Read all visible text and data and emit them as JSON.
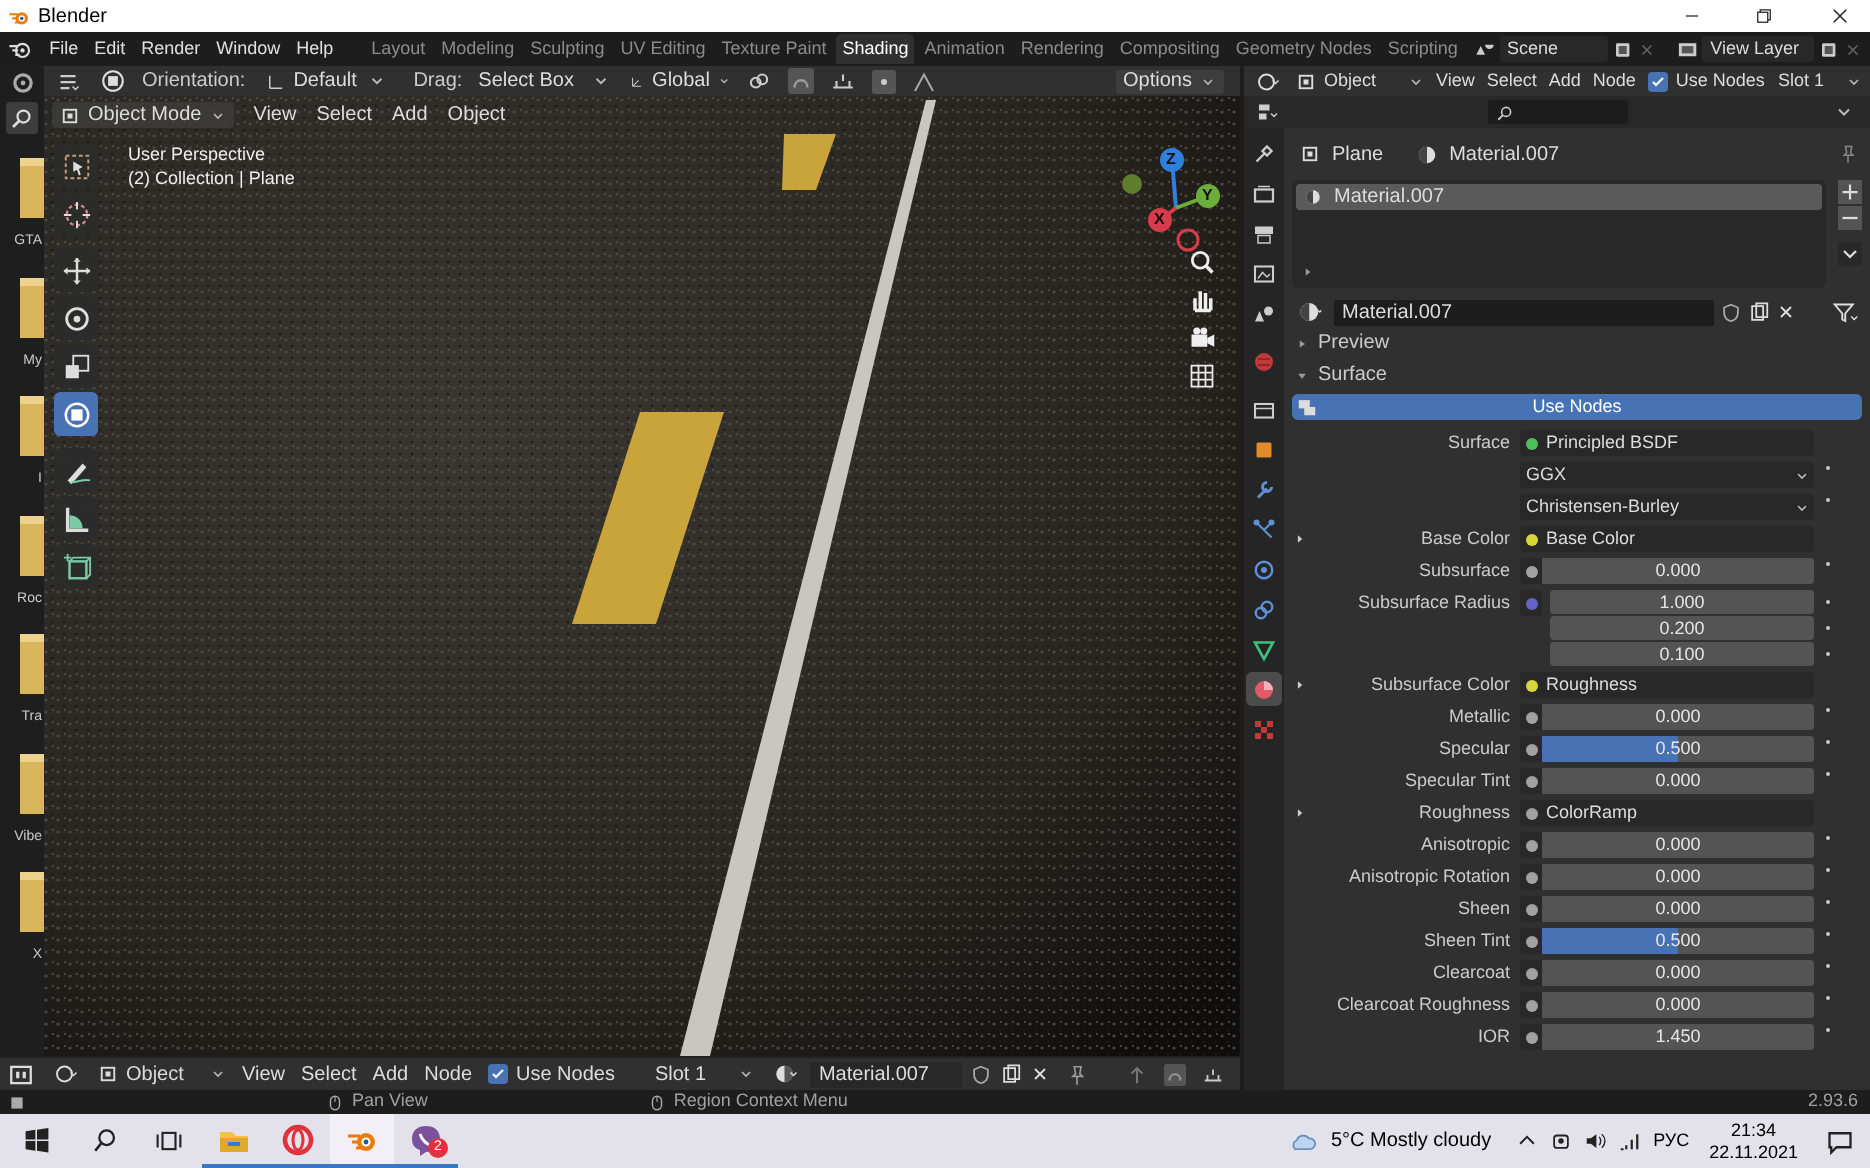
{
  "titlebar": {
    "title": "Blender"
  },
  "menu": [
    "File",
    "Edit",
    "Render",
    "Window",
    "Help"
  ],
  "workspaces": [
    {
      "label": "Layout",
      "selected": false
    },
    {
      "label": "Modeling",
      "selected": false
    },
    {
      "label": "Sculpting",
      "selected": false
    },
    {
      "label": "UV Editing",
      "selected": false
    },
    {
      "label": "Texture Paint",
      "selected": false
    },
    {
      "label": "Shading",
      "selected": true
    },
    {
      "label": "Animation",
      "selected": false
    },
    {
      "label": "Rendering",
      "selected": false
    },
    {
      "label": "Compositing",
      "selected": false
    },
    {
      "label": "Geometry Nodes",
      "selected": false
    },
    {
      "label": "Scripting",
      "selected": false
    }
  ],
  "scene": "Scene",
  "view_layer": "View Layer",
  "file_browser": {
    "items": [
      "GTA",
      "My",
      "I",
      "Roc",
      "Tra",
      "Vibe",
      "X"
    ]
  },
  "viewport": {
    "orientation_label": "Orientation:",
    "orientation": "Default",
    "drag_label": "Drag:",
    "drag": "Select Box",
    "transform": "Global",
    "options": "Options",
    "mode": "Object Mode",
    "menus": [
      "View",
      "Select",
      "Add",
      "Object"
    ],
    "overlay_text": [
      "User Perspective",
      "(2) Collection | Plane"
    ],
    "tools": [
      {
        "kind": "select",
        "selected": false
      },
      {
        "kind": "cursor",
        "selected": false
      },
      {
        "kind": "move",
        "selected": false
      },
      {
        "kind": "rotate",
        "selected": false
      },
      {
        "kind": "scale",
        "selected": false
      },
      {
        "kind": "transform",
        "selected": true
      },
      {
        "kind": "annotate",
        "selected": false
      },
      {
        "kind": "measure",
        "selected": false
      },
      {
        "kind": "add_cube",
        "selected": false
      }
    ],
    "gizmo_axes": [
      "Z",
      "Y",
      "X"
    ]
  },
  "node_header": {
    "object": "Object",
    "menus": [
      "View",
      "Select",
      "Add",
      "Node"
    ],
    "use_nodes": {
      "label": "Use Nodes",
      "checked": true
    },
    "slot": "Slot 1"
  },
  "properties": {
    "tabs": [
      {
        "kind": "tool",
        "selected": false
      },
      {
        "kind": "render",
        "selected": false
      },
      {
        "kind": "output",
        "selected": false
      },
      {
        "kind": "view_layer",
        "selected": false
      },
      {
        "kind": "scene",
        "selected": false
      },
      {
        "kind": "world",
        "selected": false
      },
      {
        "kind": "collection",
        "selected": false
      },
      {
        "kind": "object",
        "selected": false
      },
      {
        "kind": "modifiers",
        "selected": false
      },
      {
        "kind": "particles",
        "selected": false
      },
      {
        "kind": "physics",
        "selected": false
      },
      {
        "kind": "constraints",
        "selected": false
      },
      {
        "kind": "data",
        "selected": false
      },
      {
        "kind": "material",
        "selected": true
      },
      {
        "kind": "texture",
        "selected": false
      }
    ],
    "breadcrumb": [
      "Plane",
      "Material.007"
    ],
    "slots": [
      {
        "name": "Material.007",
        "selected": true
      }
    ],
    "material": "Material.007",
    "panels": [
      {
        "label": "Preview",
        "expanded": false
      },
      {
        "label": "Surface",
        "expanded": true
      }
    ],
    "use_nodes_button": "Use Nodes",
    "rows": [
      {
        "kind": "link",
        "label": "Surface",
        "value": "Principled BSDF",
        "color": "#4dbe5a",
        "expandable": false
      },
      {
        "kind": "dropdown",
        "value": "GGX"
      },
      {
        "kind": "dropdown",
        "value": "Christensen-Burley"
      },
      {
        "kind": "link",
        "label": "Base Color",
        "value": "Base Color",
        "color": "#d6d63a",
        "expandable": true
      },
      {
        "kind": "value",
        "label": "Subsurface",
        "value": "0.000",
        "level": 0,
        "color": "#a1a1a1"
      },
      {
        "kind": "vector",
        "label": "Subsurface Radius",
        "values": [
          "1.000",
          "0.200",
          "0.100"
        ],
        "color": "#6363c7"
      },
      {
        "kind": "link",
        "label": "Subsurface Color",
        "value": "Roughness",
        "color": "#d6d63a",
        "expandable": true
      },
      {
        "kind": "value",
        "label": "Metallic",
        "value": "0.000",
        "level": 0,
        "color": "#a1a1a1"
      },
      {
        "kind": "value",
        "label": "Specular",
        "value": "0.500",
        "level": 0.5,
        "color": "#a1a1a1"
      },
      {
        "kind": "value",
        "label": "Specular Tint",
        "value": "0.000",
        "level": 0,
        "color": "#a1a1a1"
      },
      {
        "kind": "link",
        "label": "Roughness",
        "value": "ColorRamp",
        "color": "#a1a1a1",
        "expandable": true
      },
      {
        "kind": "value",
        "label": "Anisotropic",
        "value": "0.000",
        "level": 0,
        "color": "#a1a1a1"
      },
      {
        "kind": "value",
        "label": "Anisotropic Rotation",
        "value": "0.000",
        "level": 0,
        "color": "#a1a1a1"
      },
      {
        "kind": "value",
        "label": "Sheen",
        "value": "0.000",
        "level": 0,
        "color": "#a1a1a1"
      },
      {
        "kind": "value",
        "label": "Sheen Tint",
        "value": "0.500",
        "level": 0.5,
        "color": "#a1a1a1"
      },
      {
        "kind": "value",
        "label": "Clearcoat",
        "value": "0.000",
        "level": 0,
        "color": "#a1a1a1"
      },
      {
        "kind": "value",
        "label": "Clearcoat Roughness",
        "value": "0.000",
        "level": 0,
        "color": "#a1a1a1"
      },
      {
        "kind": "value",
        "label": "IOR",
        "value": "1.450",
        "level": 0,
        "color": "#a1a1a1"
      }
    ]
  },
  "bottom_header": {
    "object": "Object",
    "menus": [
      "View",
      "Select",
      "Add",
      "Node"
    ],
    "use_nodes": {
      "label": "Use Nodes",
      "checked": true
    },
    "slot": "Slot 1",
    "material": "Material.007"
  },
  "status_bar": {
    "hints": [
      "Pan View",
      "Region Context Menu"
    ],
    "version": "2.93.6"
  },
  "taskbar": {
    "apps": [
      {
        "kind": "explorer",
        "active": false
      },
      {
        "kind": "opera",
        "active": false
      },
      {
        "kind": "blender",
        "active": true
      },
      {
        "kind": "viber",
        "active": false,
        "badge": "2"
      }
    ],
    "weather": "5°C Mostly cloudy",
    "language": "РУС",
    "time": "21:34",
    "date": "22.11.2021"
  }
}
